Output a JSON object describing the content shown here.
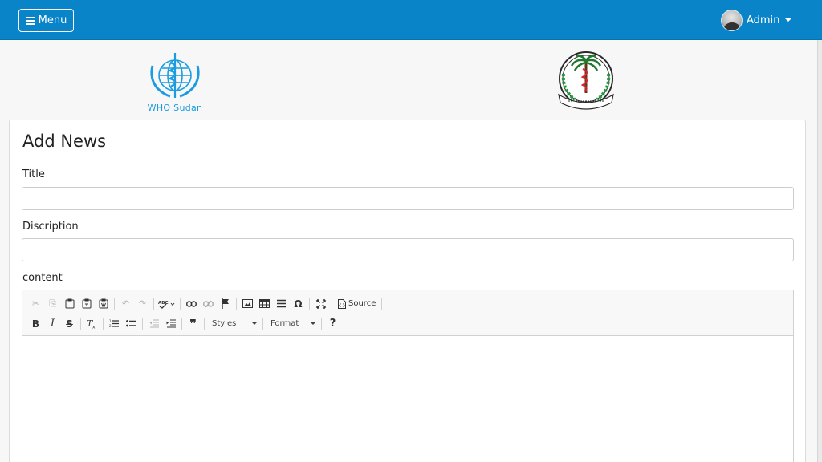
{
  "navbar": {
    "menu_label": "Menu",
    "user_name": "Admin",
    "bg_color": "#0a84c9"
  },
  "logos": {
    "left_caption": "WHO Sudan",
    "left_icon": "who-emblem",
    "right_icon": "ministry-of-health-emblem"
  },
  "form": {
    "heading": "Add News",
    "title_label": "Title",
    "title_value": "",
    "description_label": "Discription",
    "description_value": "",
    "content_label": "content"
  },
  "editor": {
    "source_label": "Source",
    "styles_label": "Styles",
    "format_label": "Format",
    "help_label": "?",
    "row1_icons": [
      "cut-icon",
      "copy-icon",
      "paste-icon",
      "paste-text-icon",
      "paste-word-icon",
      "undo-icon",
      "redo-icon",
      "spellcheck-icon",
      "link-icon",
      "unlink-icon",
      "anchor-icon",
      "image-icon",
      "table-icon",
      "horizontal-rule-icon",
      "special-char-icon",
      "maximize-icon",
      "source-icon"
    ],
    "row2_icons": [
      "bold-icon",
      "italic-icon",
      "strike-icon",
      "remove-format-icon",
      "numbered-list-icon",
      "bulleted-list-icon",
      "outdent-icon",
      "indent-icon",
      "blockquote-icon",
      "help-icon"
    ]
  }
}
